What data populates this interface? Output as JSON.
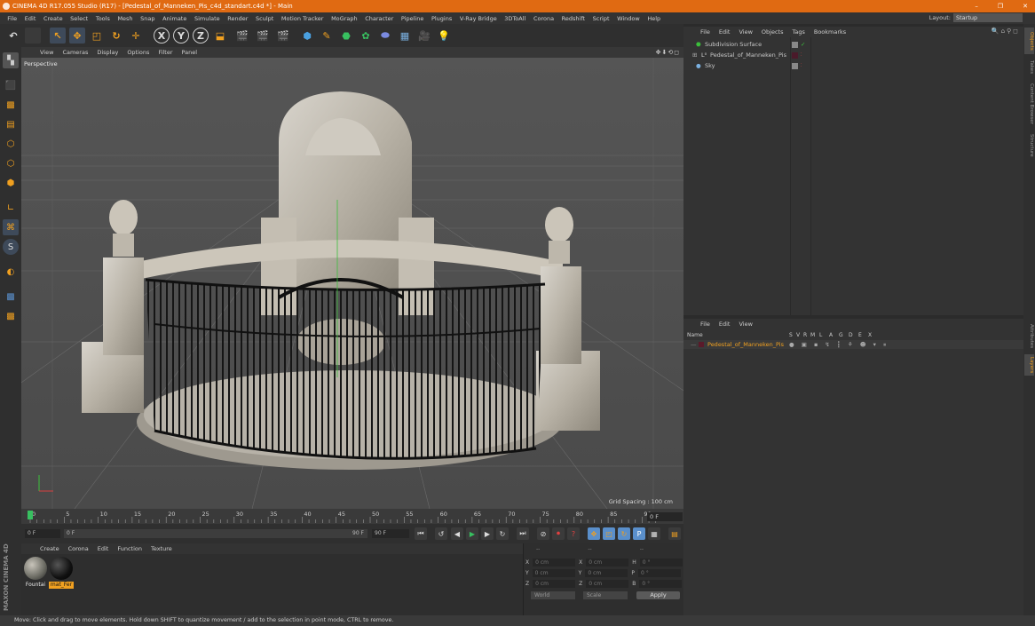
{
  "window": {
    "title": "CINEMA 4D R17.055 Studio (R17) - [Pedestal_of_Manneken_Pis_c4d_standart.c4d *] - Main",
    "controls": [
      "–",
      "❐",
      "✕"
    ]
  },
  "menubar": {
    "items": [
      "File",
      "Edit",
      "Create",
      "Select",
      "Tools",
      "Mesh",
      "Snap",
      "Animate",
      "Simulate",
      "Render",
      "Sculpt",
      "Motion Tracker",
      "MoGraph",
      "Character",
      "Pipeline",
      "Plugins",
      "V-Ray Bridge",
      "3DToAll",
      "Corona",
      "Redshift",
      "Script",
      "Window",
      "Help"
    ],
    "layout_label": "Layout:",
    "layout_value": "Startup"
  },
  "toolbar": {
    "axis_x": "X",
    "axis_y": "Y",
    "axis_z": "Z"
  },
  "viewport": {
    "menu": [
      "View",
      "Cameras",
      "Display",
      "Options",
      "Filter",
      "Panel"
    ],
    "label": "Perspective",
    "grid_spacing": "Grid Spacing : 100 cm",
    "nav_icons": "✥⬇⟲◻"
  },
  "timeline": {
    "ticks": [
      "0",
      "5",
      "10",
      "15",
      "20",
      "25",
      "30",
      "35",
      "40",
      "45",
      "50",
      "55",
      "60",
      "65",
      "70",
      "75",
      "80",
      "85",
      "90"
    ],
    "end_frame": "0 F"
  },
  "transport": {
    "start_field": "0 F",
    "current_field": "0 F",
    "end_field": "90 F",
    "max_field": "90 F"
  },
  "material_manager": {
    "menu": [
      "Create",
      "Corona",
      "Edit",
      "Function",
      "Texture"
    ],
    "materials": [
      {
        "label": "Fountai",
        "color": "#6a6a62"
      },
      {
        "label": "mat_Fer",
        "color": "#111111"
      }
    ]
  },
  "brand": {
    "text": "MAXON CINEMA 4D"
  },
  "coordinates": {
    "header": [
      "--",
      "--",
      "--"
    ],
    "rows": [
      {
        "a": "X",
        "av": "0 cm",
        "b": "X",
        "bv": "0 cm",
        "c": "H",
        "cv": "0 °"
      },
      {
        "a": "Y",
        "av": "0 cm",
        "b": "Y",
        "bv": "0 cm",
        "c": "P",
        "cv": "0 °"
      },
      {
        "a": "Z",
        "av": "0 cm",
        "b": "Z",
        "bv": "0 cm",
        "c": "B",
        "cv": "0 °"
      }
    ],
    "mode": "World",
    "scale": "Scale",
    "apply": "Apply"
  },
  "status": {
    "text": "Move: Click and drag to move elements. Hold down SHIFT to quantize movement / add to the selection in point mode, CTRL to remove."
  },
  "object_manager": {
    "menu": [
      "File",
      "Edit",
      "View",
      "Objects",
      "Tags",
      "Bookmarks"
    ],
    "objects": [
      {
        "name": "Subdivision Surface",
        "color": "#8cc6e8"
      },
      {
        "name": "Pedestal_of_Manneken_Pis",
        "color": "#d0d0d0"
      },
      {
        "name": "Sky",
        "color": "#d0d0d0"
      }
    ]
  },
  "attribute_manager": {
    "menu": [
      "File",
      "Edit",
      "View"
    ],
    "name_col": "Name",
    "flag_cols": [
      "S",
      "V",
      "R",
      "M",
      "L",
      "A",
      "G",
      "D",
      "E",
      "X"
    ],
    "row_name": "Pedestal_of_Manneken_Pis"
  },
  "right_tabs": [
    "Objects",
    "Takes",
    "Content Browser",
    "Structure",
    "Attributes",
    "Layers"
  ],
  "colors": {
    "accent": "#e06a12",
    "selection_orange": "#f0a020",
    "active_blue": "#5a8fcb"
  }
}
